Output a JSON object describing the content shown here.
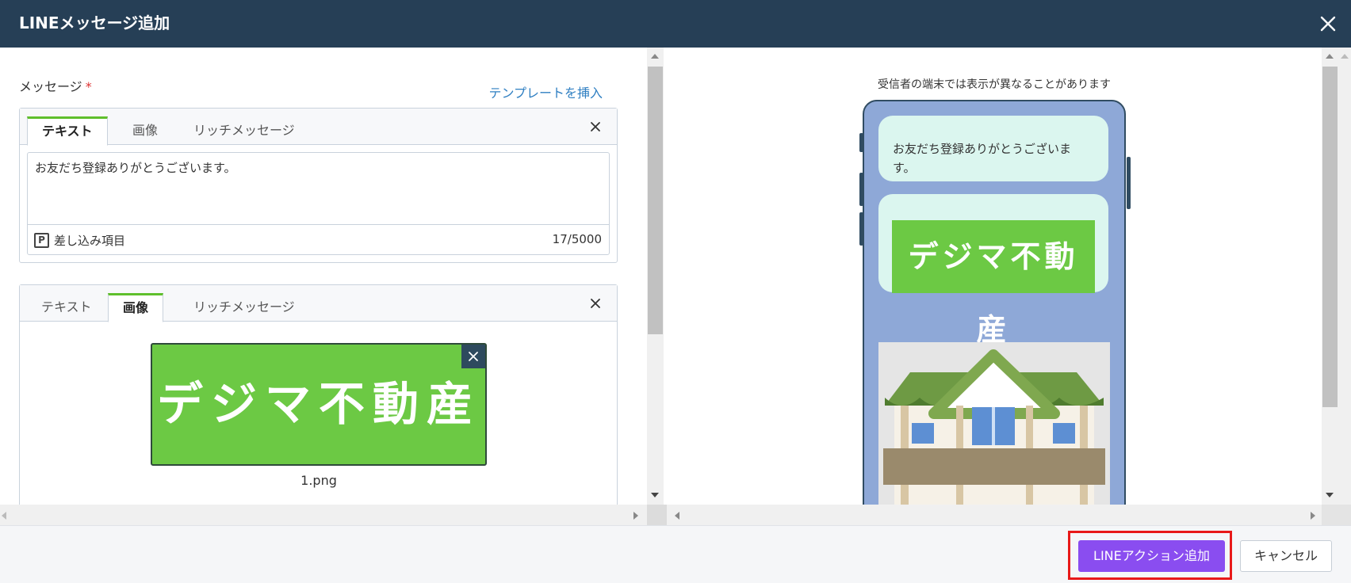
{
  "header": {
    "title": "LINEメッセージ追加"
  },
  "editor": {
    "message_label": "メッセージ",
    "required_mark": "*",
    "template_link": "テンプレートを挿入",
    "tabs": [
      "テキスト",
      "画像",
      "リッチメッセージ"
    ],
    "text_card": {
      "active_tab": "テキスト",
      "body": "お友だち登録ありがとうございます。",
      "insert_field_icon": "P",
      "insert_field_label": "差し込み項目",
      "counter": "17/5000"
    },
    "image_card": {
      "active_tab": "画像",
      "image_text": "デジマ不動産",
      "file_name": "1.png"
    }
  },
  "preview": {
    "note": "受信者の端末では表示が異なることがあります",
    "bubble_text": "お友だち登録ありがとうございます。",
    "bubble_image_text": "デジマ不動産"
  },
  "footer": {
    "primary_button": "LINEアクション追加",
    "cancel_button": "キャンセル"
  },
  "colors": {
    "header_bg": "#263f56",
    "accent_green": "#5fbf2c",
    "primary_button": "#8a4df0",
    "highlight": "#e81919",
    "link": "#2f7fc2"
  }
}
